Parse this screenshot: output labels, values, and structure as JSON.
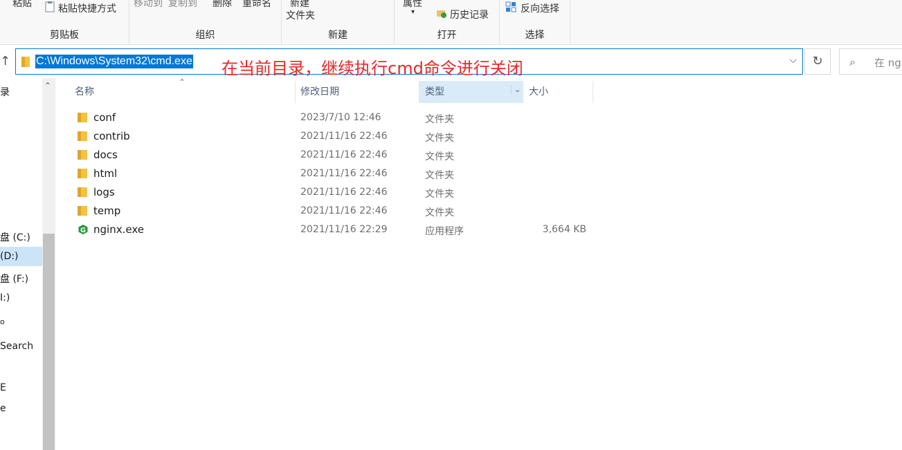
{
  "ribbon": {
    "paste_label": "粘贴",
    "paste_shortcut_label": "粘贴快捷方式",
    "move_to_label": "移动到",
    "copy_to_label": "复制到",
    "delete_label": "删除",
    "rename_label": "重命名",
    "new_folder_line1": "新建",
    "new_folder_line2": "文件夹",
    "properties_label": "属性",
    "history_label": "历史记录",
    "invert_selection_label": "反向选择",
    "groups": {
      "clipboard": "剪贴板",
      "organize": "组织",
      "new": "新建",
      "open": "打开",
      "select": "选择"
    }
  },
  "address_bar": {
    "path": "C:\\Windows\\System32\\cmd.exe"
  },
  "annotation": "在当前目录，继续执行cmd命令进行关闭",
  "search": {
    "placeholder": "在 ngi"
  },
  "nav_pane": {
    "items": [
      "录",
      "盘 (C:)",
      "(D:)",
      "盘 (F:)",
      "I:)",
      "o",
      "Search",
      "E",
      "e"
    ],
    "selected": "(D:)"
  },
  "columns": {
    "name": "名称",
    "date": "修改日期",
    "type": "类型",
    "size": "大小"
  },
  "files": [
    {
      "name": "conf",
      "date": "2023/7/10 12:46",
      "type": "文件夹",
      "size": "",
      "icon": "folder-icon"
    },
    {
      "name": "contrib",
      "date": "2021/11/16 22:46",
      "type": "文件夹",
      "size": "",
      "icon": "folder-icon"
    },
    {
      "name": "docs",
      "date": "2021/11/16 22:46",
      "type": "文件夹",
      "size": "",
      "icon": "folder-icon"
    },
    {
      "name": "html",
      "date": "2021/11/16 22:46",
      "type": "文件夹",
      "size": "",
      "icon": "folder-icon"
    },
    {
      "name": "logs",
      "date": "2021/11/16 22:46",
      "type": "文件夹",
      "size": "",
      "icon": "folder-icon"
    },
    {
      "name": "temp",
      "date": "2021/11/16 22:46",
      "type": "文件夹",
      "size": "",
      "icon": "folder-icon"
    },
    {
      "name": "nginx.exe",
      "date": "2021/11/16 22:29",
      "type": "应用程序",
      "size": "3,664 KB",
      "icon": "nginx-icon"
    }
  ],
  "colors": {
    "accent": "#0078d7",
    "annotation": "#e8272b",
    "selected": "#cce4f7",
    "folder": "#f2c343"
  }
}
